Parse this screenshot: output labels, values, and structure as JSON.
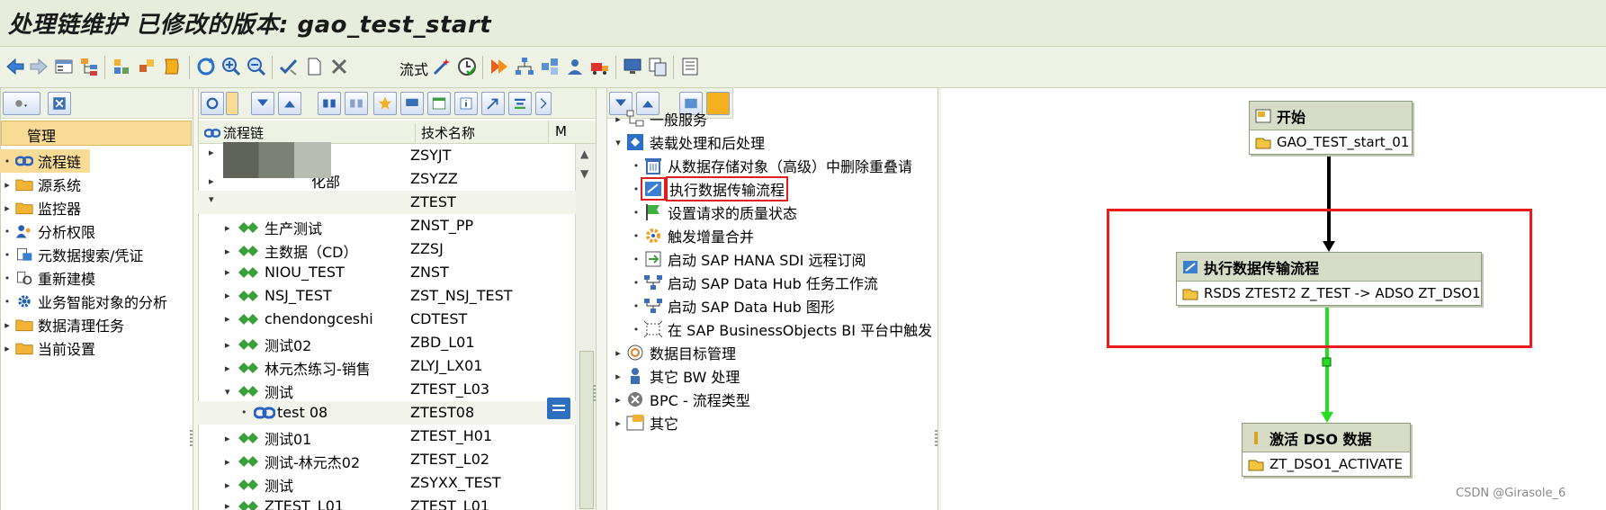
{
  "window": {
    "title_prefix": "处理链维护 已修改的版本: ",
    "title_object": "gao_test_start"
  },
  "toolbar": {
    "text_button": "流式"
  },
  "panel1": {
    "header": "管理",
    "items": [
      {
        "label": "流程链",
        "icon": "chain-icon",
        "selected": true
      },
      {
        "label": "源系统",
        "icon": "folder-icon"
      },
      {
        "label": "监控器",
        "icon": "folder-icon"
      },
      {
        "label": "分析权限",
        "icon": "users-icon"
      },
      {
        "label": "元数据搜索/凭证",
        "icon": "metadata-icon"
      },
      {
        "label": "重新建模",
        "icon": "remodel-icon"
      },
      {
        "label": "业务智能对象的分析",
        "icon": "gear-icon"
      },
      {
        "label": "数据清理任务",
        "icon": "folder-icon"
      },
      {
        "label": "当前设置",
        "icon": "folder-icon"
      }
    ]
  },
  "panel2": {
    "col_name": "流程链",
    "col_tech": "技术名称",
    "col_m": "M",
    "rows": [
      {
        "name": "",
        "tech": "ZSYJT"
      },
      {
        "name": "化部",
        "tech": "ZSYZZ"
      },
      {
        "name": "",
        "tech": "ZTEST"
      },
      {
        "name": "生产测试",
        "tech": "ZNST_PP"
      },
      {
        "name": "主数据（CD）",
        "tech": "ZZSJ"
      },
      {
        "name": "NIOU_TEST",
        "tech": "ZNST"
      },
      {
        "name": "NSJ_TEST",
        "tech": "ZST_NSJ_TEST"
      },
      {
        "name": "chendongceshi",
        "tech": "CDTEST"
      },
      {
        "name": "测试02",
        "tech": "ZBD_L01"
      },
      {
        "name": "林元杰练习-销售",
        "tech": "ZLYJ_LX01"
      },
      {
        "name": "测试",
        "tech": "ZTEST_L03"
      },
      {
        "name": "test 08",
        "tech": "ZTEST08"
      },
      {
        "name": "测试01",
        "tech": "ZTEST_H01"
      },
      {
        "name": "测试-林元杰02",
        "tech": "ZTEST_L02"
      },
      {
        "name": "测试",
        "tech": "ZSYXX_TEST"
      },
      {
        "name": "ZTEST_L01",
        "tech": "ZTEST_L01"
      }
    ]
  },
  "panel3": {
    "items": [
      {
        "label": "一般服务",
        "level": 0
      },
      {
        "label": "装载处理和后处理",
        "level": 0
      },
      {
        "label": "从数据存储对象（高级）中删除重叠请",
        "level": 1
      },
      {
        "label": "执行数据传输流程",
        "level": 1
      },
      {
        "label": "设置请求的质量状态",
        "level": 1
      },
      {
        "label": "触发增量合并",
        "level": 1
      },
      {
        "label": "启动 SAP HANA SDI 远程订阅",
        "level": 1
      },
      {
        "label": "启动 SAP Data Hub 任务工作流",
        "level": 1
      },
      {
        "label": "启动 SAP Data Hub 图形",
        "level": 1
      },
      {
        "label": "在 SAP BusinessObjects BI 平台中触发",
        "level": 1
      },
      {
        "label": "数据目标管理",
        "level": 0
      },
      {
        "label": "其它 BW 处理",
        "level": 0
      },
      {
        "label": "BPC - 流程类型",
        "level": 0
      },
      {
        "label": "其它",
        "level": 0
      }
    ]
  },
  "canvas": {
    "start": {
      "title": "开始",
      "variant": "GAO_TEST_start_01"
    },
    "dtp": {
      "title": "执行数据传输流程",
      "variant": "RSDS ZTEST2 Z_TEST -> ADSO ZT_DSO1"
    },
    "activate": {
      "title": "激活 DSO 数据",
      "variant": "ZT_DSO1_ACTIVATE"
    },
    "colors": {
      "red_outline": "#e81c1c",
      "green_link": "#22dd22",
      "black_link": "#000000"
    }
  },
  "watermark": "CSDN @Girasole_6"
}
